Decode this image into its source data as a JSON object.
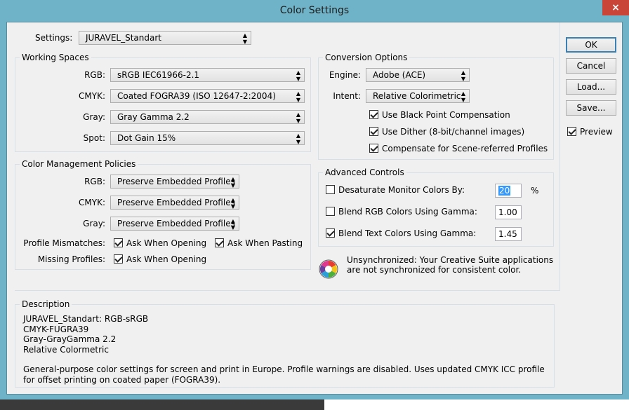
{
  "window": {
    "title": "Color Settings",
    "close": "×"
  },
  "settings": {
    "label": "Settings:",
    "value": "JURAVEL_Standart"
  },
  "working_spaces": {
    "legend": "Working Spaces",
    "rows": [
      {
        "label": "RGB:",
        "value": "sRGB IEC61966-2.1"
      },
      {
        "label": "CMYK:",
        "value": "Coated FOGRA39 (ISO 12647-2:2004)"
      },
      {
        "label": "Gray:",
        "value": "Gray Gamma 2.2"
      },
      {
        "label": "Spot:",
        "value": "Dot Gain 15%"
      }
    ]
  },
  "policies": {
    "legend": "Color Management Policies",
    "rows": [
      {
        "label": "RGB:",
        "value": "Preserve Embedded Profiles"
      },
      {
        "label": "CMYK:",
        "value": "Preserve Embedded Profiles"
      },
      {
        "label": "Gray:",
        "value": "Preserve Embedded Profiles"
      }
    ],
    "mismatches_label": "Profile Mismatches:",
    "ask_opening": {
      "label": "Ask When Opening",
      "checked": true
    },
    "ask_pasting": {
      "label": "Ask When Pasting",
      "checked": true
    },
    "missing_label": "Missing Profiles:",
    "missing_ask_opening": {
      "label": "Ask When Opening",
      "checked": true
    }
  },
  "conversion": {
    "legend": "Conversion Options",
    "engine_label": "Engine:",
    "engine_value": "Adobe (ACE)",
    "intent_label": "Intent:",
    "intent_value": "Relative Colorimetric",
    "black_point": {
      "label": "Use Black Point Compensation",
      "checked": true
    },
    "dither": {
      "label": "Use Dither (8-bit/channel images)",
      "checked": true
    },
    "scene": {
      "label": "Compensate for Scene-referred Profiles",
      "checked": true
    }
  },
  "advanced": {
    "legend": "Advanced Controls",
    "desaturate": {
      "label": "Desaturate Monitor Colors By:",
      "checked": false,
      "value": "20",
      "unit": "%"
    },
    "blend_rgb": {
      "label": "Blend RGB Colors Using Gamma:",
      "checked": false,
      "value": "1.00"
    },
    "blend_text": {
      "label": "Blend Text Colors Using Gamma:",
      "checked": true,
      "value": "1.45"
    }
  },
  "sync": {
    "icon": "color-wheel-icon",
    "line1": "Unsynchronized: Your Creative Suite applications",
    "line2": "are not synchronized for consistent color."
  },
  "buttons": {
    "ok": "OK",
    "cancel": "Cancel",
    "load": "Load...",
    "save": "Save..."
  },
  "preview": {
    "label": "Preview",
    "checked": true
  },
  "description": {
    "legend": "Description",
    "line1": "JURAVEL_Standart:  RGB-sRGB",
    "line2": "CMYK-FUGRA39",
    "line3": "Gray-GrayGamma 2.2",
    "line4": "Relative Colormetric",
    "paragraph": "General-purpose color settings for screen and print in Europe. Profile warnings are disabled. Uses updated CMYK ICC profile for offset printing on coated paper (FOGRA39)."
  },
  "colors": {
    "window_frame": "#6fb3c8",
    "close_button": "#c84538",
    "dialog_bg": "#f0f0f0",
    "selection": "#3399ff"
  }
}
